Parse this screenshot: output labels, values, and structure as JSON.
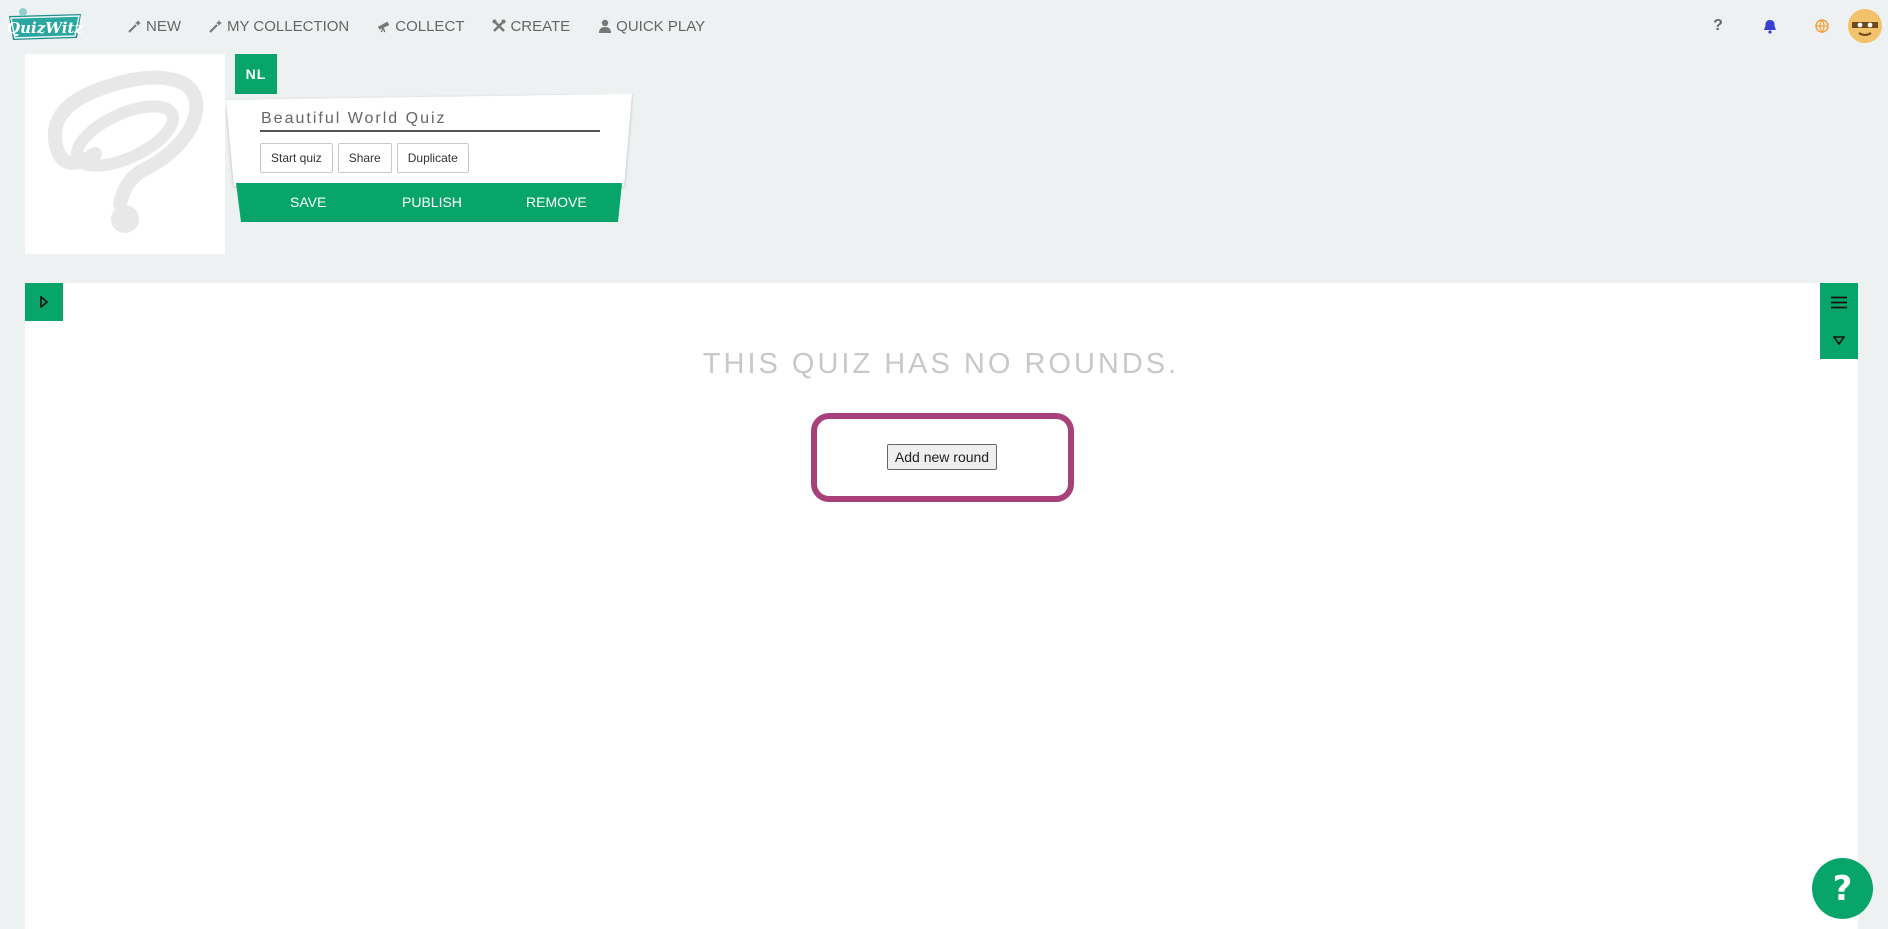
{
  "app": {
    "logo_text": "QuizWitz",
    "brand_color": "#08a56a",
    "highlight_color": "#a8417a"
  },
  "nav": [
    {
      "label": "NEW",
      "icon": "wand-icon"
    },
    {
      "label": "MY COLLECTION",
      "icon": "wand-icon"
    },
    {
      "label": "COLLECT",
      "icon": "telescope-icon"
    },
    {
      "label": "CREATE",
      "icon": "tools-icon"
    },
    {
      "label": "QUICK PLAY",
      "icon": "user-icon"
    }
  ],
  "header_icons": [
    "help-icon",
    "bell-icon",
    "globe-icon",
    "avatar"
  ],
  "quiz": {
    "language": "NL",
    "title": "Beautiful World Quiz",
    "actions": [
      "Start quiz",
      "Share",
      "Duplicate"
    ],
    "primary_actions": [
      "SAVE",
      "PUBLISH",
      "REMOVE"
    ]
  },
  "main": {
    "empty_message": "THIS QUIZ HAS NO ROUNDS.",
    "add_round_label": "Add new round"
  },
  "help_fab": "?"
}
